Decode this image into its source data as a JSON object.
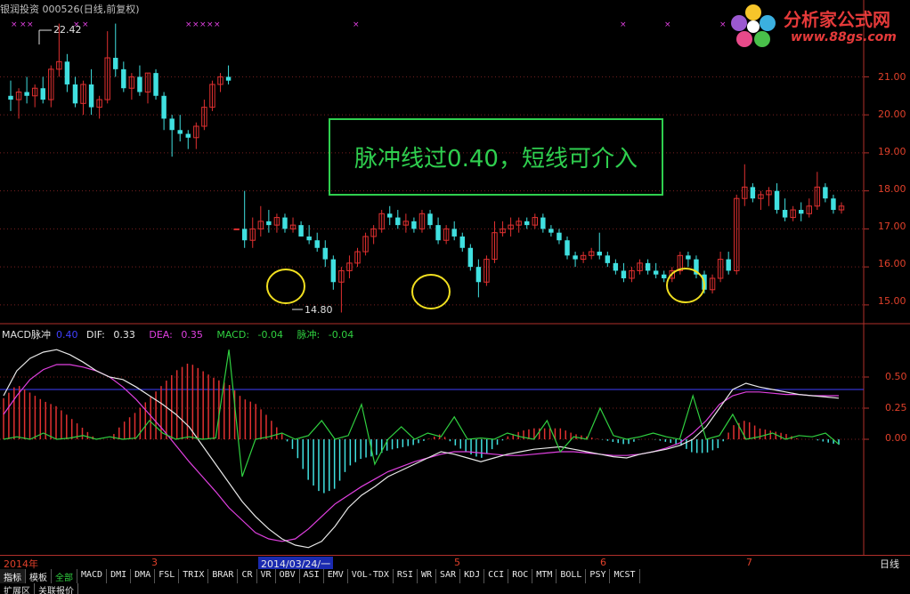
{
  "header": {
    "stock_name": "银润投资",
    "stock_code": "000526",
    "period_info": "(日线,前复权)"
  },
  "logo": {
    "title": "分析家公式网",
    "url": "www.88gs.com"
  },
  "price_panel": {
    "high_marker": "22.42",
    "low_marker": "14.80",
    "y_ticks": [
      "21.00",
      "20.00",
      "19.00",
      "18.00",
      "17.00",
      "16.00",
      "15.00"
    ],
    "annotation": "脉冲线过0.40，短线可介入"
  },
  "macd_panel": {
    "indicator_name": "MACD脉冲",
    "threshold": "0.40",
    "dif_label": "DIF:",
    "dif_value": "0.33",
    "dea_label": "DEA:",
    "dea_value": "0.35",
    "macd_label": "MACD:",
    "macd_value": "-0.04",
    "pulse_label": "脉冲:",
    "pulse_value": "-0.04",
    "y_ticks": [
      "0.50",
      "0.25",
      "0.00"
    ],
    "colors": {
      "dif": "#e8e8e8",
      "dea": "#e040e0",
      "macd": "#30d040",
      "pulse": "#30d040",
      "threshold": "#4040ff"
    }
  },
  "time_axis": {
    "labels": [
      "2014年",
      "3",
      "5",
      "6",
      "7"
    ],
    "cursor_date": "2014/03/24/一",
    "period": "日线"
  },
  "tabs": [
    "指标",
    "模板",
    "全部",
    "MACD",
    "DMI",
    "DMA",
    "FSL",
    "TRIX",
    "BRAR",
    "CR",
    "VR",
    "OBV",
    "ASI",
    "EMV",
    "VOL-TDX",
    "RSI",
    "WR",
    "SAR",
    "KDJ",
    "CCI",
    "ROC",
    "MTM",
    "BOLL",
    "PSY",
    "MCST"
  ],
  "bottom_bar": [
    "扩展区",
    "关联报价"
  ],
  "chart_data": {
    "type": "candlestick",
    "price_range": [
      14.6,
      22.6
    ],
    "candles": [
      [
        20.5,
        20.9,
        20.1,
        20.4
      ],
      [
        20.4,
        20.7,
        19.9,
        20.6
      ],
      [
        20.6,
        21.0,
        20.3,
        20.5
      ],
      [
        20.5,
        20.8,
        20.2,
        20.7
      ],
      [
        20.7,
        21.0,
        20.3,
        20.4
      ],
      [
        20.4,
        21.3,
        20.2,
        21.2
      ],
      [
        21.2,
        22.4,
        21.0,
        21.4
      ],
      [
        21.4,
        21.6,
        20.6,
        20.8
      ],
      [
        20.8,
        21.0,
        20.2,
        20.3
      ],
      [
        20.3,
        20.9,
        20.0,
        20.8
      ],
      [
        20.8,
        21.2,
        20.0,
        20.2
      ],
      [
        20.2,
        20.5,
        19.9,
        20.4
      ],
      [
        20.4,
        22.2,
        20.3,
        21.5
      ],
      [
        21.5,
        22.4,
        21.0,
        21.2
      ],
      [
        21.2,
        21.4,
        20.6,
        20.7
      ],
      [
        20.7,
        21.1,
        20.4,
        21.0
      ],
      [
        21.0,
        21.3,
        20.5,
        20.6
      ],
      [
        20.6,
        21.1,
        20.3,
        21.1
      ],
      [
        21.1,
        21.2,
        20.4,
        20.5
      ],
      [
        20.5,
        20.6,
        19.6,
        19.9
      ],
      [
        19.9,
        20.0,
        18.9,
        19.6
      ],
      [
        19.6,
        20.0,
        19.3,
        19.5
      ],
      [
        19.5,
        19.6,
        19.1,
        19.4
      ],
      [
        19.4,
        19.8,
        19.1,
        19.7
      ],
      [
        19.7,
        20.4,
        19.6,
        20.2
      ],
      [
        20.2,
        20.9,
        20.1,
        20.8
      ],
      [
        20.8,
        21.1,
        20.6,
        21.0
      ],
      [
        21.0,
        21.3,
        20.8,
        20.9
      ],
      [
        17.0,
        17.0,
        17.0,
        17.0
      ],
      [
        17.0,
        18.0,
        16.5,
        16.7
      ],
      [
        16.7,
        17.3,
        16.5,
        17.0
      ],
      [
        17.0,
        17.6,
        16.8,
        17.2
      ],
      [
        17.2,
        17.5,
        16.9,
        17.1
      ],
      [
        17.1,
        17.4,
        16.9,
        17.3
      ],
      [
        17.3,
        17.4,
        16.9,
        17.0
      ],
      [
        17.0,
        17.3,
        16.9,
        17.1
      ],
      [
        17.1,
        17.2,
        16.8,
        16.8
      ],
      [
        16.8,
        17.1,
        16.6,
        16.7
      ],
      [
        16.7,
        16.9,
        16.4,
        16.5
      ],
      [
        16.5,
        16.7,
        16.0,
        16.2
      ],
      [
        16.2,
        16.3,
        15.4,
        15.6
      ],
      [
        15.6,
        16.0,
        14.8,
        15.9
      ],
      [
        15.9,
        16.3,
        15.7,
        16.1
      ],
      [
        16.1,
        16.5,
        16.0,
        16.4
      ],
      [
        16.4,
        16.9,
        16.3,
        16.8
      ],
      [
        16.8,
        17.1,
        16.6,
        17.0
      ],
      [
        17.0,
        17.5,
        16.9,
        17.4
      ],
      [
        17.4,
        17.6,
        17.1,
        17.3
      ],
      [
        17.3,
        17.5,
        17.0,
        17.1
      ],
      [
        17.1,
        17.4,
        16.9,
        17.2
      ],
      [
        17.2,
        17.3,
        16.9,
        17.0
      ],
      [
        17.0,
        17.5,
        16.9,
        17.4
      ],
      [
        17.4,
        17.5,
        17.0,
        17.1
      ],
      [
        17.1,
        17.3,
        16.6,
        16.7
      ],
      [
        16.7,
        17.1,
        16.6,
        17.0
      ],
      [
        17.0,
        17.2,
        16.7,
        16.8
      ],
      [
        16.8,
        16.9,
        16.4,
        16.5
      ],
      [
        16.5,
        16.6,
        15.9,
        16.0
      ],
      [
        16.0,
        16.2,
        15.2,
        15.6
      ],
      [
        15.6,
        16.3,
        15.5,
        16.2
      ],
      [
        16.2,
        17.2,
        16.1,
        16.9
      ],
      [
        16.9,
        17.2,
        16.8,
        17.0
      ],
      [
        17.0,
        17.3,
        16.8,
        17.1
      ],
      [
        17.1,
        17.3,
        16.9,
        17.2
      ],
      [
        17.2,
        17.3,
        17.0,
        17.1
      ],
      [
        17.1,
        17.4,
        17.0,
        17.3
      ],
      [
        17.3,
        17.4,
        16.9,
        17.0
      ],
      [
        17.0,
        17.1,
        16.8,
        16.9
      ],
      [
        16.9,
        17.0,
        16.6,
        16.7
      ],
      [
        16.7,
        16.8,
        16.2,
        16.3
      ],
      [
        16.3,
        16.4,
        16.0,
        16.2
      ],
      [
        16.2,
        16.4,
        16.1,
        16.3
      ],
      [
        16.3,
        16.5,
        16.2,
        16.4
      ],
      [
        16.4,
        16.9,
        16.2,
        16.3
      ],
      [
        16.3,
        16.4,
        16.0,
        16.1
      ],
      [
        16.1,
        16.2,
        15.8,
        15.9
      ],
      [
        15.9,
        16.1,
        15.6,
        15.7
      ],
      [
        15.7,
        16.0,
        15.6,
        15.9
      ],
      [
        15.9,
        16.2,
        15.8,
        16.1
      ],
      [
        16.1,
        16.2,
        15.8,
        15.9
      ],
      [
        15.9,
        16.1,
        15.7,
        15.8
      ],
      [
        15.8,
        15.9,
        15.6,
        15.7
      ],
      [
        15.7,
        16.0,
        15.6,
        15.9
      ],
      [
        15.9,
        16.4,
        15.8,
        16.3
      ],
      [
        16.3,
        16.4,
        16.0,
        16.2
      ],
      [
        16.2,
        16.3,
        15.7,
        15.8
      ],
      [
        15.8,
        15.9,
        15.3,
        15.4
      ],
      [
        15.4,
        15.8,
        15.3,
        15.7
      ],
      [
        15.7,
        16.4,
        15.6,
        16.2
      ],
      [
        16.2,
        16.4,
        15.8,
        15.9
      ],
      [
        15.9,
        17.9,
        15.8,
        17.8
      ],
      [
        17.8,
        18.7,
        17.6,
        18.1
      ],
      [
        18.1,
        18.2,
        17.7,
        17.8
      ],
      [
        17.8,
        18.0,
        17.5,
        17.9
      ],
      [
        17.9,
        18.1,
        17.6,
        18.0
      ],
      [
        18.0,
        18.2,
        17.4,
        17.5
      ],
      [
        17.5,
        17.8,
        17.2,
        17.3
      ],
      [
        17.3,
        17.6,
        17.2,
        17.5
      ],
      [
        17.5,
        17.7,
        17.2,
        17.4
      ],
      [
        17.4,
        17.8,
        17.3,
        17.6
      ],
      [
        17.6,
        18.5,
        17.5,
        18.1
      ],
      [
        18.1,
        18.2,
        17.7,
        17.8
      ],
      [
        17.8,
        17.9,
        17.4,
        17.5
      ],
      [
        17.5,
        17.7,
        17.4,
        17.6
      ]
    ],
    "macd": {
      "range": [
        -0.9,
        0.8
      ],
      "threshold": 0.4,
      "dif": [
        0.35,
        0.55,
        0.65,
        0.7,
        0.72,
        0.68,
        0.62,
        0.55,
        0.5,
        0.48,
        0.42,
        0.35,
        0.28,
        0.2,
        0.1,
        -0.05,
        -0.2,
        -0.35,
        -0.5,
        -0.62,
        -0.72,
        -0.8,
        -0.85,
        -0.87,
        -0.82,
        -0.7,
        -0.55,
        -0.45,
        -0.38,
        -0.3,
        -0.25,
        -0.2,
        -0.15,
        -0.1,
        -0.12,
        -0.15,
        -0.18,
        -0.15,
        -0.12,
        -0.1,
        -0.08,
        -0.07,
        -0.06,
        -0.08,
        -0.1,
        -0.12,
        -0.14,
        -0.15,
        -0.12,
        -0.1,
        -0.08,
        -0.05,
        0.0,
        0.1,
        0.25,
        0.4,
        0.45,
        0.42,
        0.4,
        0.38,
        0.36,
        0.35,
        0.34,
        0.33
      ],
      "dea": [
        0.2,
        0.35,
        0.48,
        0.56,
        0.6,
        0.6,
        0.58,
        0.55,
        0.5,
        0.42,
        0.32,
        0.2,
        0.08,
        -0.05,
        -0.18,
        -0.3,
        -0.42,
        -0.55,
        -0.65,
        -0.75,
        -0.8,
        -0.82,
        -0.8,
        -0.72,
        -0.62,
        -0.52,
        -0.45,
        -0.38,
        -0.32,
        -0.26,
        -0.22,
        -0.18,
        -0.15,
        -0.12,
        -0.1,
        -0.1,
        -0.11,
        -0.12,
        -0.13,
        -0.13,
        -0.12,
        -0.11,
        -0.1,
        -0.1,
        -0.11,
        -0.12,
        -0.13,
        -0.13,
        -0.12,
        -0.1,
        -0.07,
        -0.03,
        0.05,
        0.15,
        0.28,
        0.35,
        0.38,
        0.38,
        0.37,
        0.36,
        0.36,
        0.35,
        0.35,
        0.35
      ],
      "pulse": [
        0.0,
        0.02,
        0.0,
        0.05,
        0.0,
        0.01,
        0.03,
        0.0,
        0.02,
        0.0,
        0.01,
        0.15,
        0.05,
        0.0,
        0.02,
        0.0,
        0.01,
        0.72,
        -0.3,
        0.0,
        0.02,
        0.05,
        0.0,
        0.03,
        0.15,
        0.0,
        0.03,
        0.28,
        -0.2,
        0.0,
        0.1,
        0.0,
        0.05,
        0.02,
        0.18,
        0.0,
        0.01,
        0.0,
        0.05,
        0.02,
        0.0,
        0.15,
        -0.1,
        0.02,
        0.0,
        0.25,
        0.03,
        0.0,
        0.02,
        0.05,
        0.02,
        0.0,
        0.35,
        0.0,
        0.03,
        0.2,
        0.0,
        0.02,
        0.05,
        0.0,
        0.03,
        0.02,
        0.05,
        -0.04
      ]
    }
  }
}
